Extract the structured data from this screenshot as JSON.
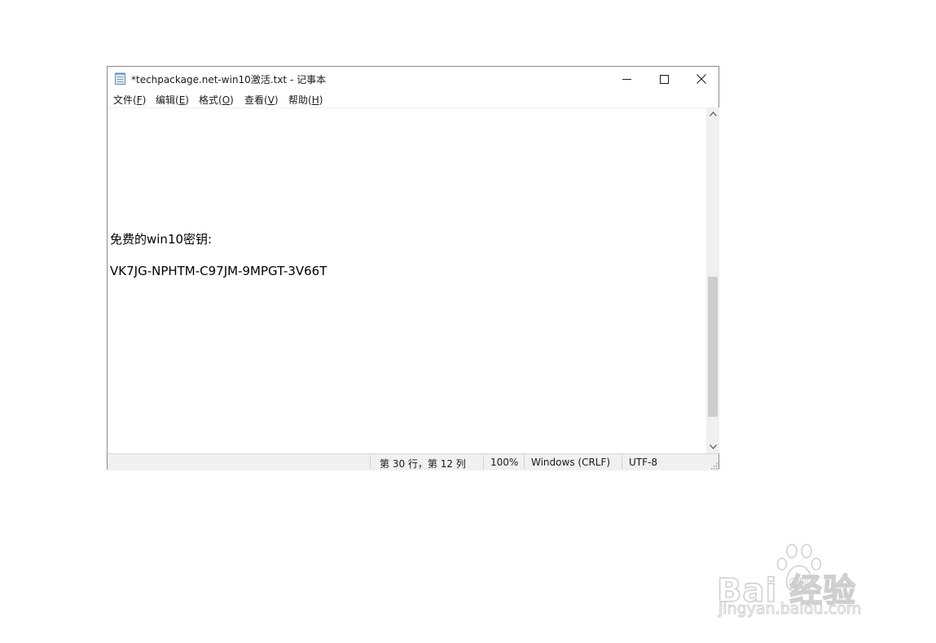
{
  "window": {
    "title": "*techpackage.net-win10激活.txt - 记事本"
  },
  "menu": {
    "items": [
      {
        "label": "文件(",
        "accel": "F",
        "end": ")"
      },
      {
        "label": "编辑(",
        "accel": "E",
        "end": ")"
      },
      {
        "label": "格式(",
        "accel": "O",
        "end": ")"
      },
      {
        "label": "查看(",
        "accel": "V",
        "end": ")"
      },
      {
        "label": "帮助(",
        "accel": "H",
        "end": ")"
      }
    ]
  },
  "editor": {
    "lines": [
      "免费的win10密钥:",
      "VK7JG-NPHTM-C97JM-9MPGT-3V66T"
    ]
  },
  "status": {
    "position": "第 30 行，第 12 列",
    "zoom": "100%",
    "line_ending": "Windows (CRLF)",
    "encoding": "UTF-8"
  },
  "watermark": {
    "brand": "Bai  经验",
    "url": "jingyan.baidu.com"
  },
  "colors": {
    "scroll_thumb": "#cdcdcd",
    "statusbar": "#f0f0f0"
  }
}
